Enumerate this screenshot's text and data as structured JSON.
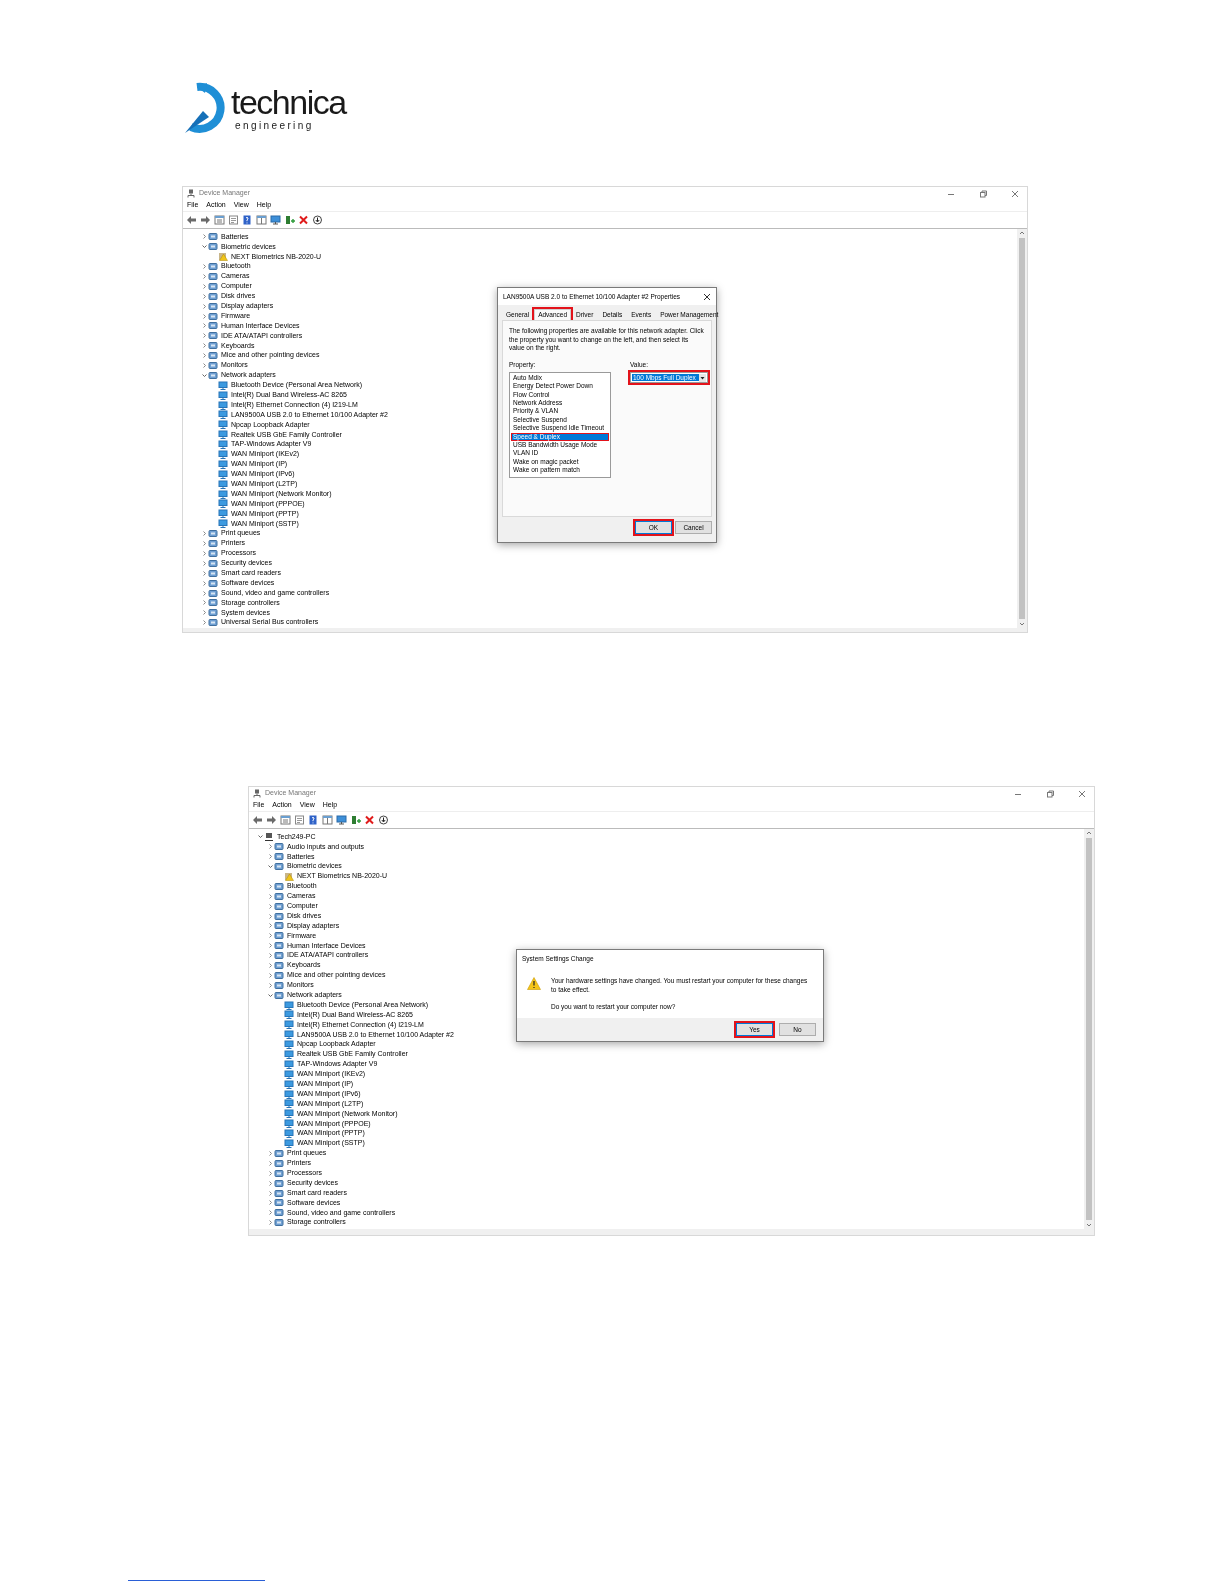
{
  "logo": {
    "name": "technica",
    "tagline": "engineering"
  },
  "screenshots": [
    {
      "window": {
        "title": "Device Manager"
      },
      "menu": [
        "File",
        "Action",
        "View",
        "Help"
      ],
      "tree": {
        "categories": [
          {
            "label": "Batteries",
            "expanded": false
          },
          {
            "label": "Biometric devices",
            "expanded": true,
            "children": [
              {
                "label": "NEXT Biometrics NB-2020-U",
                "warning": true
              }
            ]
          },
          {
            "label": "Bluetooth",
            "expanded": false
          },
          {
            "label": "Cameras",
            "expanded": false
          },
          {
            "label": "Computer",
            "expanded": false
          },
          {
            "label": "Disk drives",
            "expanded": false
          },
          {
            "label": "Display adapters",
            "expanded": false
          },
          {
            "label": "Firmware",
            "expanded": false
          },
          {
            "label": "Human Interface Devices",
            "expanded": false
          },
          {
            "label": "IDE ATA/ATAPI controllers",
            "expanded": false
          },
          {
            "label": "Keyboards",
            "expanded": false
          },
          {
            "label": "Mice and other pointing devices",
            "expanded": false
          },
          {
            "label": "Monitors",
            "expanded": false
          },
          {
            "label": "Network adapters",
            "expanded": true,
            "children": [
              {
                "label": "Bluetooth Device (Personal Area Network)"
              },
              {
                "label": "Intel(R) Dual Band Wireless-AC 8265"
              },
              {
                "label": "Intel(R) Ethernet Connection (4) I219-LM"
              },
              {
                "label": "LAN9500A USB 2.0 to Ethernet 10/100 Adapter #2"
              },
              {
                "label": "Npcap Loopback Adapter"
              },
              {
                "label": "Realtek USB GbE Family Controller"
              },
              {
                "label": "TAP-Windows Adapter V9"
              },
              {
                "label": "WAN Miniport (IKEv2)"
              },
              {
                "label": "WAN Miniport (IP)"
              },
              {
                "label": "WAN Miniport (IPv6)"
              },
              {
                "label": "WAN Miniport (L2TP)"
              },
              {
                "label": "WAN Miniport (Network Monitor)"
              },
              {
                "label": "WAN Miniport (PPPOE)"
              },
              {
                "label": "WAN Miniport (PPTP)"
              },
              {
                "label": "WAN Miniport (SSTP)"
              }
            ]
          },
          {
            "label": "Print queues",
            "expanded": false
          },
          {
            "label": "Printers",
            "expanded": false
          },
          {
            "label": "Processors",
            "expanded": false
          },
          {
            "label": "Security devices",
            "expanded": false
          },
          {
            "label": "Smart card readers",
            "expanded": false
          },
          {
            "label": "Software devices",
            "expanded": false
          },
          {
            "label": "Sound, video and game controllers",
            "expanded": false
          },
          {
            "label": "Storage controllers",
            "expanded": false
          },
          {
            "label": "System devices",
            "expanded": false
          },
          {
            "label": "Universal Serial Bus controllers",
            "expanded": false
          }
        ]
      },
      "dialog": {
        "kind": "properties",
        "title": "LAN9500A USB 2.0 to Ethernet 10/100 Adapter #2 Properties",
        "tabs": [
          {
            "label": "General",
            "selected": false,
            "highlighted": false
          },
          {
            "label": "Advanced",
            "selected": true,
            "highlighted": true
          },
          {
            "label": "Driver",
            "selected": false,
            "highlighted": false
          },
          {
            "label": "Details",
            "selected": false,
            "highlighted": false
          },
          {
            "label": "Events",
            "selected": false,
            "highlighted": false
          },
          {
            "label": "Power Management",
            "selected": false,
            "highlighted": false
          }
        ],
        "description": "The following properties are available for this network adapter. Click the property you want to change on the left, and then select its value on the right.",
        "property_label": "Property:",
        "properties": [
          {
            "label": "Auto Mdix",
            "selected": false,
            "highlighted": false
          },
          {
            "label": "Energy Detect Power Down",
            "selected": false,
            "highlighted": false
          },
          {
            "label": "Flow Control",
            "selected": false,
            "highlighted": false
          },
          {
            "label": "Network Address",
            "selected": false,
            "highlighted": false
          },
          {
            "label": "Priority & VLAN",
            "selected": false,
            "highlighted": false
          },
          {
            "label": "Selective Suspend",
            "selected": false,
            "highlighted": false
          },
          {
            "label": "Selective Suspend Idle Timeout",
            "selected": false,
            "highlighted": false
          },
          {
            "label": "Speed & Duplex",
            "selected": true,
            "highlighted": true
          },
          {
            "label": "USB Bandwidth Usage Mode",
            "selected": false,
            "highlighted": false
          },
          {
            "label": "VLAN ID",
            "selected": false,
            "highlighted": false
          },
          {
            "label": "Wake on magic packet",
            "selected": false,
            "highlighted": false
          },
          {
            "label": "Wake on pattern match",
            "selected": false,
            "highlighted": false
          }
        ],
        "value_label": "Value:",
        "value": {
          "text": "100 Mbps Full Duplex",
          "highlighted": true
        },
        "buttons": [
          {
            "label": "OK",
            "highlighted": true
          },
          {
            "label": "Cancel",
            "highlighted": false
          }
        ]
      }
    },
    {
      "window": {
        "title": "Device Manager"
      },
      "menu": [
        "File",
        "Action",
        "View",
        "Help"
      ],
      "tree": {
        "root": {
          "label": "Tech249-PC",
          "expanded": true
        },
        "categories": [
          {
            "label": "Audio inputs and outputs",
            "expanded": false
          },
          {
            "label": "Batteries",
            "expanded": false
          },
          {
            "label": "Biometric devices",
            "expanded": true,
            "children": [
              {
                "label": "NEXT Biometrics NB-2020-U",
                "warning": true
              }
            ]
          },
          {
            "label": "Bluetooth",
            "expanded": false
          },
          {
            "label": "Cameras",
            "expanded": false
          },
          {
            "label": "Computer",
            "expanded": false
          },
          {
            "label": "Disk drives",
            "expanded": false
          },
          {
            "label": "Display adapters",
            "expanded": false
          },
          {
            "label": "Firmware",
            "expanded": false
          },
          {
            "label": "Human Interface Devices",
            "expanded": false
          },
          {
            "label": "IDE ATA/ATAPI controllers",
            "expanded": false
          },
          {
            "label": "Keyboards",
            "expanded": false
          },
          {
            "label": "Mice and other pointing devices",
            "expanded": false
          },
          {
            "label": "Monitors",
            "expanded": false
          },
          {
            "label": "Network adapters",
            "expanded": true,
            "children": [
              {
                "label": "Bluetooth Device (Personal Area Network)"
              },
              {
                "label": "Intel(R) Dual Band Wireless-AC 8265"
              },
              {
                "label": "Intel(R) Ethernet Connection (4) I219-LM"
              },
              {
                "label": "LAN9500A USB 2.0 to Ethernet 10/100 Adapter #2"
              },
              {
                "label": "Npcap Loopback Adapter"
              },
              {
                "label": "Realtek USB GbE Family Controller"
              },
              {
                "label": "TAP-Windows Adapter V9"
              },
              {
                "label": "WAN Miniport (IKEv2)"
              },
              {
                "label": "WAN Miniport (IP)"
              },
              {
                "label": "WAN Miniport (IPv6)"
              },
              {
                "label": "WAN Miniport (L2TP)"
              },
              {
                "label": "WAN Miniport (Network Monitor)"
              },
              {
                "label": "WAN Miniport (PPPOE)"
              },
              {
                "label": "WAN Miniport (PPTP)"
              },
              {
                "label": "WAN Miniport (SSTP)"
              }
            ]
          },
          {
            "label": "Print queues",
            "expanded": false
          },
          {
            "label": "Printers",
            "expanded": false
          },
          {
            "label": "Processors",
            "expanded": false
          },
          {
            "label": "Security devices",
            "expanded": false
          },
          {
            "label": "Smart card readers",
            "expanded": false
          },
          {
            "label": "Software devices",
            "expanded": false
          },
          {
            "label": "Sound, video and game controllers",
            "expanded": false
          },
          {
            "label": "Storage controllers",
            "expanded": false
          }
        ]
      },
      "dialog": {
        "kind": "message",
        "title": "System Settings Change",
        "message": "Your hardware settings have changed. You must restart your computer for these changes to take effect.",
        "question": "Do you want to restart your computer now?",
        "buttons": [
          {
            "label": "Yes",
            "highlighted": true
          },
          {
            "label": "No",
            "highlighted": false
          }
        ]
      }
    }
  ]
}
